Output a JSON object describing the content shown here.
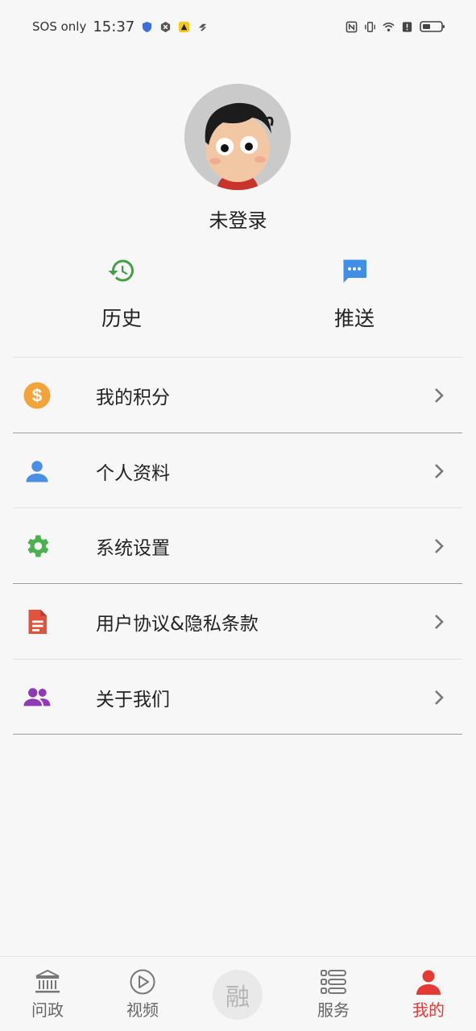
{
  "status_bar": {
    "carrier": "SOS only",
    "time": "15:37"
  },
  "profile": {
    "username": "未登录"
  },
  "shortcuts": [
    {
      "label": "历史",
      "icon": "history-icon",
      "color": "#43a047"
    },
    {
      "label": "推送",
      "icon": "message-icon",
      "color": "#3f8ee8"
    }
  ],
  "menu": [
    {
      "label": "我的积分",
      "icon": "coin-icon",
      "color": "#f2a33a"
    },
    {
      "label": "个人资料",
      "icon": "person-icon",
      "color": "#4a90e2"
    },
    {
      "label": "系统设置",
      "icon": "gear-icon",
      "color": "#4caf50"
    },
    {
      "label": "用户协议&隐私条款",
      "icon": "document-icon",
      "color": "#e0533d"
    },
    {
      "label": "关于我们",
      "icon": "group-icon",
      "color": "#8e3ab5"
    }
  ],
  "bottom_nav": [
    {
      "label": "问政",
      "icon": "bank-icon"
    },
    {
      "label": "视频",
      "icon": "play-icon"
    },
    {
      "label": "融",
      "icon": "center-logo"
    },
    {
      "label": "服务",
      "icon": "list-icon"
    },
    {
      "label": "我的",
      "icon": "person-icon",
      "active": true
    }
  ],
  "colors": {
    "accent": "#e53935",
    "background": "#f7f7f7"
  }
}
